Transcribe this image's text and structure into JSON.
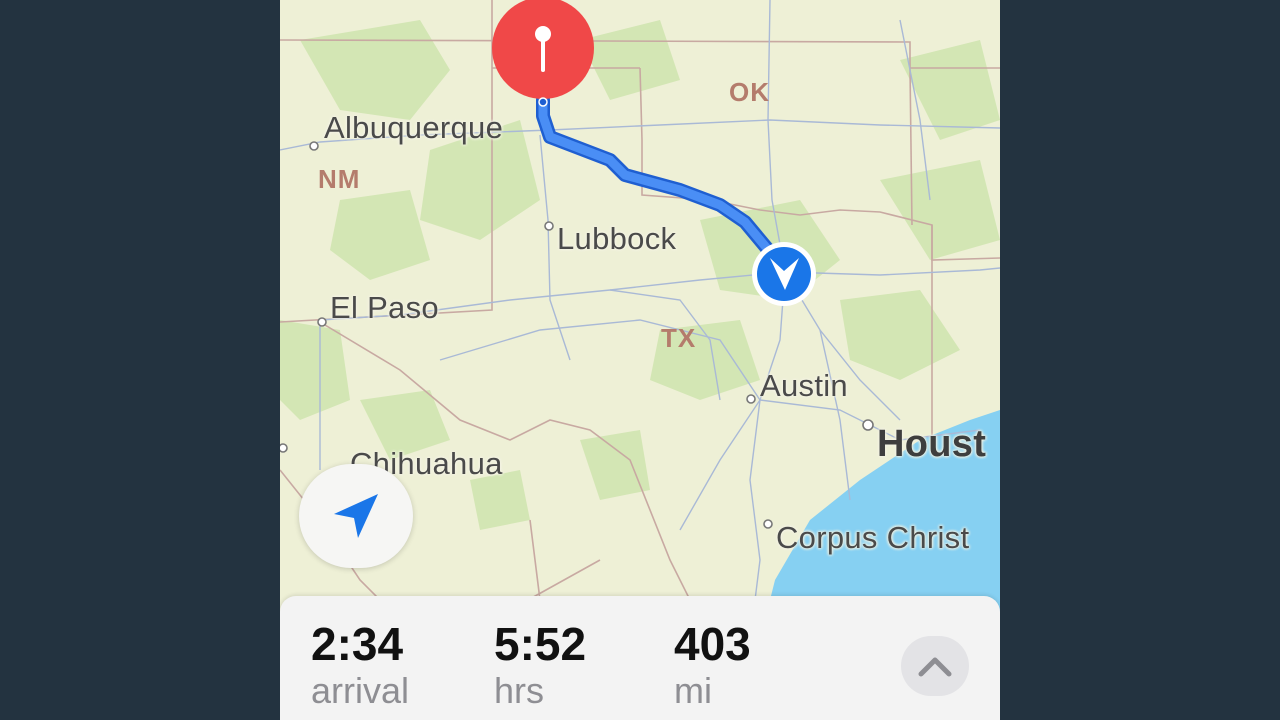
{
  "map": {
    "cities": {
      "albuquerque": "Albuquerque",
      "lubbock": "Lubbock",
      "el_paso": "El Paso",
      "austin": "Austin",
      "houston": "Houst",
      "chihuahua": "Chihuahua",
      "corpus_christi": "Corpus Christ"
    },
    "states": {
      "ok": "OK",
      "nm": "NM",
      "tx": "TX"
    },
    "colors": {
      "land": "#eef0d6",
      "park_green": "#d3e6b4",
      "water": "#86d0f2",
      "route": "#3b82f6",
      "pin": "#f04848"
    },
    "icons": {
      "destination": "map-pin-icon",
      "current_location": "navigation-arrow-icon",
      "locate_button": "location-arrow-icon"
    }
  },
  "trip": {
    "arrival": {
      "value": "2:34",
      "label": "arrival"
    },
    "duration": {
      "value": "5:52",
      "label": "hrs"
    },
    "distance": {
      "value": "403",
      "label": "mi"
    }
  },
  "panel": {
    "expand_icon": "chevron-up-icon"
  }
}
